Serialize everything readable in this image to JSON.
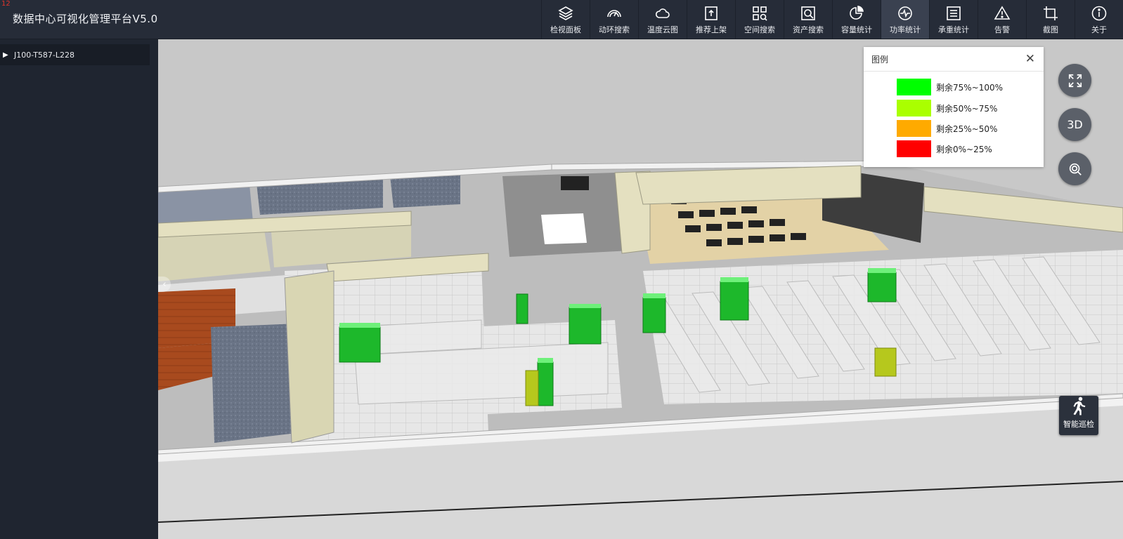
{
  "corner_number": "12",
  "app": {
    "title": "数据中心可视化管理平台V5.0"
  },
  "toolbar": {
    "items": [
      {
        "label": "检视面板",
        "icon": "layers-icon"
      },
      {
        "label": "动环搜索",
        "icon": "gauge-icon"
      },
      {
        "label": "温度云图",
        "icon": "cloud-icon"
      },
      {
        "label": "推荐上架",
        "icon": "upload-icon"
      },
      {
        "label": "空间搜索",
        "icon": "grid-search-icon"
      },
      {
        "label": "资产搜索",
        "icon": "asset-search-icon"
      },
      {
        "label": "容量统计",
        "icon": "pie-chart-icon"
      },
      {
        "label": "功率统计",
        "icon": "pulse-icon",
        "active": true
      },
      {
        "label": "承重统计",
        "icon": "list-icon"
      },
      {
        "label": "告警",
        "icon": "warning-icon"
      },
      {
        "label": "截图",
        "icon": "crop-icon"
      },
      {
        "label": "关于",
        "icon": "info-icon"
      }
    ]
  },
  "sidebar": {
    "tree": [
      {
        "label": "J100-T587-L228",
        "expanded": false
      }
    ]
  },
  "legend": {
    "title": "图例",
    "items": [
      {
        "label": "剩余75%~100%",
        "color": "#00ff00"
      },
      {
        "label": "剩余50%~75%",
        "color": "#aaff00"
      },
      {
        "label": "剩余25%~50%",
        "color": "#ffaa00"
      },
      {
        "label": "剩余0%~25%",
        "color": "#ff0000"
      }
    ]
  },
  "view_controls": {
    "fullscreen_icon": "fullscreen-icon",
    "mode_label": "3D",
    "search_icon": "view-search-icon"
  },
  "patrol": {
    "label": "智能巡检"
  }
}
